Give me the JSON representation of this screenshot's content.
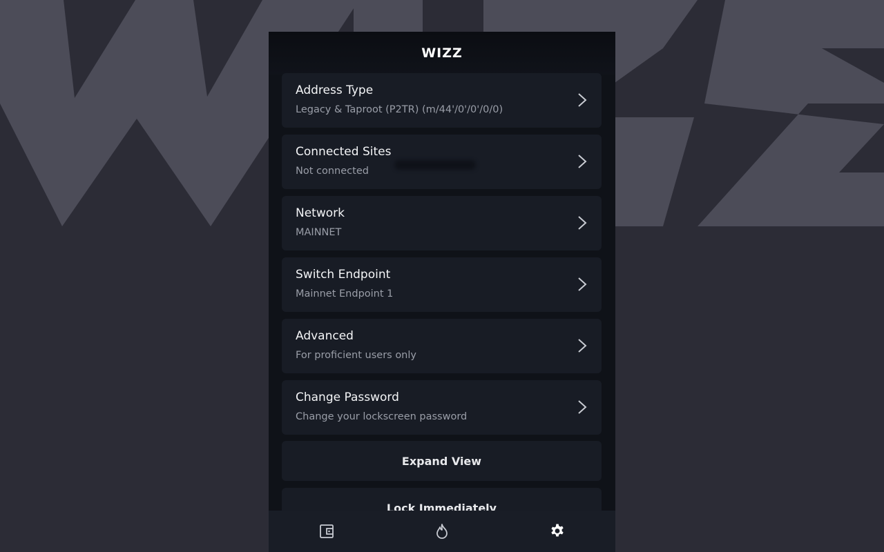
{
  "brand": {
    "logo_text": "WIZZ"
  },
  "settings": {
    "items": [
      {
        "title": "Address Type",
        "subtitle": "Legacy & Taproot (P2TR) (m/44'/0'/0'/0/0)"
      },
      {
        "title": "Connected Sites",
        "subtitle": "Not connected"
      },
      {
        "title": "Network",
        "subtitle": "MAINNET"
      },
      {
        "title": "Switch Endpoint",
        "subtitle": "Mainnet Endpoint 1"
      },
      {
        "title": "Advanced",
        "subtitle": "For proficient users only"
      },
      {
        "title": "Change Password",
        "subtitle": "Change your lockscreen password"
      }
    ],
    "buttons": {
      "expand": "Expand View",
      "lock": "Lock Immediately"
    }
  },
  "tabbar": {
    "tabs": [
      {
        "icon": "wallet-icon",
        "active": false
      },
      {
        "icon": "flame-icon",
        "active": false
      },
      {
        "icon": "gear-icon",
        "active": true
      }
    ]
  },
  "colors": {
    "background": "#2c2c36",
    "background_art": "#4c4c58",
    "panel": "#0f1218",
    "card": "#181c25",
    "title_text": "#f4f5f7",
    "subtitle_text": "#9a9ea8"
  }
}
